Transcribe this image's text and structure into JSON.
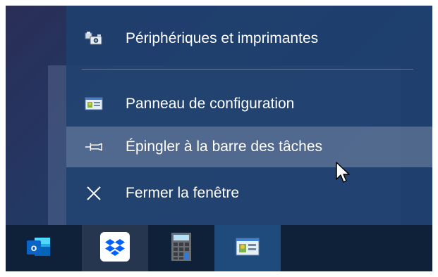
{
  "jumplist": {
    "items": [
      {
        "label": "Périphériques et imprimantes",
        "icon": "devices-printers-icon"
      },
      {
        "label": "Panneau de configuration",
        "icon": "control-panel-icon"
      },
      {
        "label": "Épingler à la barre des tâches",
        "icon": "pin-icon"
      },
      {
        "label": "Fermer la fenêtre",
        "icon": "close-icon"
      }
    ]
  },
  "taskbar": {
    "apps": [
      {
        "name": "outlook-icon",
        "letter": "o"
      },
      {
        "name": "dropbox-icon"
      },
      {
        "name": "calculator-icon"
      },
      {
        "name": "control-panel-icon"
      }
    ]
  },
  "colors": {
    "menu_bg": "#1f406e",
    "taskbar_bg": "#0f2138",
    "active_task": "#1f4a7c",
    "outlook_blue": "#0a64c8",
    "dropbox_blue": "#0061fe"
  }
}
